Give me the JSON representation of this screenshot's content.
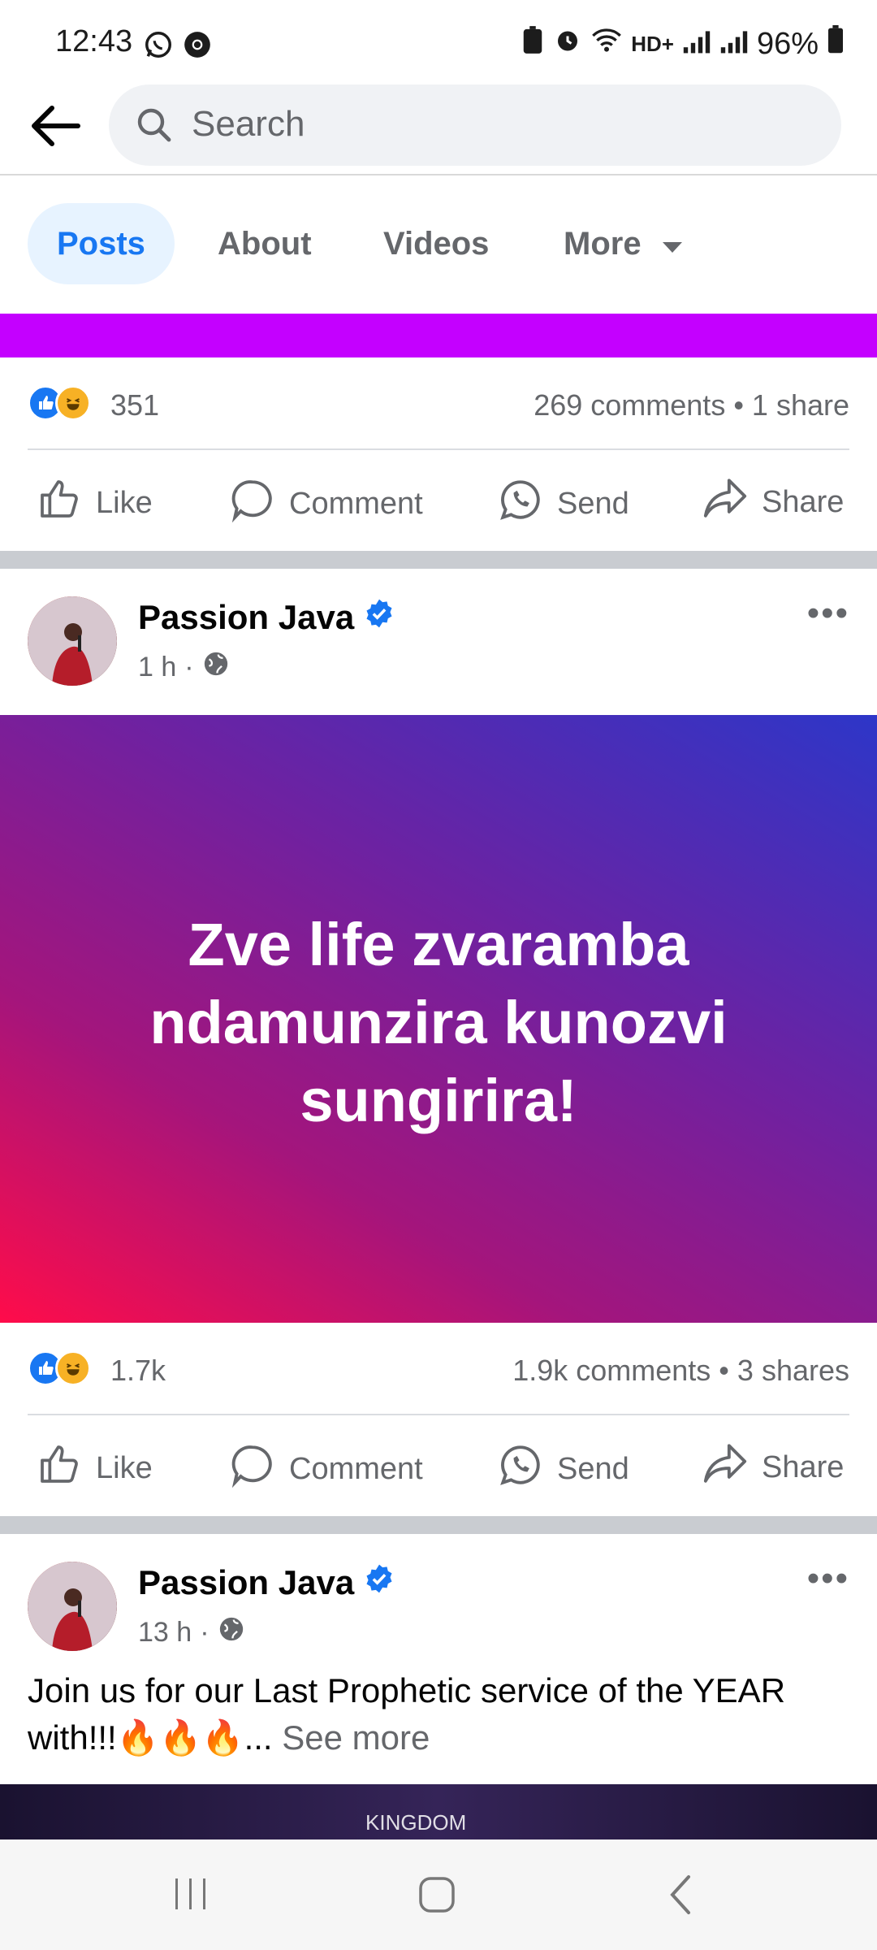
{
  "status_bar": {
    "time": "12:43",
    "battery": "96%"
  },
  "search": {
    "placeholder": "Search"
  },
  "tabs": [
    {
      "label": "Posts"
    },
    {
      "label": "About"
    },
    {
      "label": "Videos"
    },
    {
      "label": "More"
    }
  ],
  "post_prev": {
    "reaction_count": "351",
    "comments_shares": "269 comments • 1 share"
  },
  "actions": {
    "like": "Like",
    "comment": "Comment",
    "send": "Send",
    "share": "Share"
  },
  "post1": {
    "author": "Passion Java",
    "time": "1 h",
    "banner_text": "Zve life zvaramba ndamunzira kunozvi sungirira!",
    "reaction_count": "1.7k",
    "comments_shares": "1.9k comments • 3 shares"
  },
  "post2": {
    "author": "Passion Java",
    "time": "13 h",
    "text": "Join us for our Last Prophetic service of the YEAR with!!!🔥🔥🔥...",
    "see_more": "See more",
    "image_text": "KINGDOM"
  },
  "colors": {
    "accent": "#1877f2",
    "strip": "#c400ff"
  }
}
